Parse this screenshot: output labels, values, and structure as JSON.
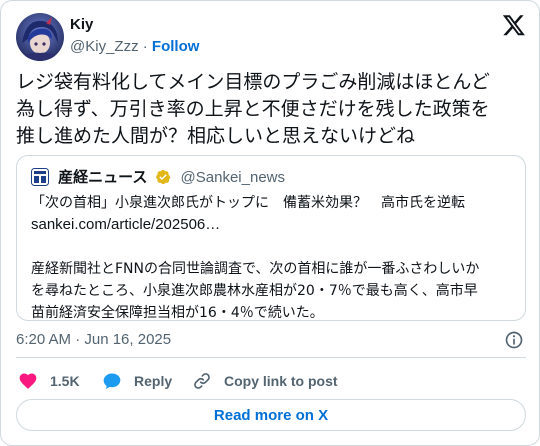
{
  "author": {
    "display_name": "Kiy",
    "handle": "@Kiy_Zzz",
    "separator": "·",
    "follow_label": "Follow"
  },
  "tweet": {
    "lines": [
      "レジ袋有料化してメイン目標のプラごみ削減はほとんど",
      "為し得ず、万引き率の上昇と不便さだけを残した政策を",
      "推し進めた人間が？相応しいと思えないけどね"
    ],
    "timestamp": "6:20 AM · Jun 16, 2025"
  },
  "quote": {
    "name": "産経ニュース",
    "handle": "@Sankei_news",
    "title_line": "「次の首相」小泉進次郎氏がトップに　備蓄米効果？　高市氏を逆転",
    "url": "sankei.com/article/202506…",
    "body_lines": [
      "産経新聞社とFNNの合同世論調査で、次の首相に誰が一番ふさわしいか",
      "を尋ねたところ、小泉進次郎農林水産相が20・7％で最も高く、高市早",
      "苗前経済安全保障担当相が16・4％で続いた。"
    ]
  },
  "actions": {
    "like_count": "1.5K",
    "reply_label": "Reply",
    "copy_label": "Copy link to post"
  },
  "read_more_label": "Read more on X",
  "colors": {
    "link_blue": "#006fd6",
    "like_pink": "#f91880",
    "reply_blue": "#1d9bf0",
    "secondary_text": "#536471",
    "border": "#cfd9de",
    "verified_gold": "#e2b719"
  },
  "icons": [
    "avatar",
    "x-logo-icon",
    "sankei-logo-icon",
    "verified-badge-icon",
    "info-icon",
    "heart-icon",
    "reply-icon",
    "link-icon"
  ]
}
